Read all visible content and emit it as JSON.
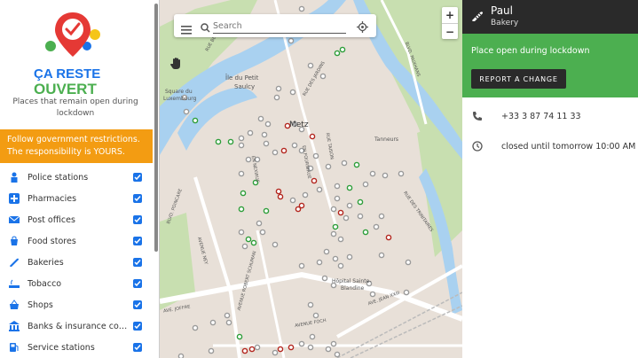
{
  "app": {
    "logo_line1": "ÇA RESTE",
    "logo_line2": "OUVERT",
    "tagline": "Places that remain open during lockdown"
  },
  "warning": {
    "line1": "Follow government restrictions.",
    "line2": "The responsibility is YOURS."
  },
  "categories": [
    {
      "label": "Police stations",
      "icon": "police-icon",
      "checked": true
    },
    {
      "label": "Pharmacies",
      "icon": "pharmacy-icon",
      "checked": true
    },
    {
      "label": "Post offices",
      "icon": "mail-icon",
      "checked": true
    },
    {
      "label": "Food stores",
      "icon": "shopping-basket-icon",
      "checked": true
    },
    {
      "label": "Bakeries",
      "icon": "bread-icon",
      "checked": true
    },
    {
      "label": "Tobacco",
      "icon": "cigarette-icon",
      "checked": true
    },
    {
      "label": "Shops",
      "icon": "shop-basket-icon",
      "checked": true
    },
    {
      "label": "Banks & insurance com...",
      "icon": "bank-icon",
      "checked": true
    },
    {
      "label": "Service stations",
      "icon": "fuel-icon",
      "checked": true
    }
  ],
  "search": {
    "placeholder": "Search"
  },
  "zoom": {
    "in": "+",
    "out": "−"
  },
  "map_labels": {
    "ile": "Île du Petit",
    "ile2": "Saulcy",
    "square": "Square du",
    "square2": "Luxembourg",
    "metz": "Metz",
    "tanneurs": "Tanneurs",
    "hopital": "Hôpital Sainte-",
    "hopital2": "Blandine",
    "r_belle": "RUE BELLE-",
    "r_jardins": "RUE DES JARDINS",
    "r_serpenoise": "EN NEXIRUE",
    "r_fournirue": "EN FOURNIRUE",
    "r_taison": "RUE TAISON",
    "r_pasteur": "AVENUE NEY",
    "r_robert": "AVENUE ROBERT SCHUMAN",
    "r_poincare": "BLVD. POINCARE",
    "r_foch": "AVENUE FOCH",
    "r_joffre": "AVE. JOFFRE",
    "r_jean": "AVE. JEAN XXIII",
    "r_paixhans": "BLVD. PAIXHANS",
    "r_trinitaires": "RUE DES TRINITAIRES"
  },
  "detail": {
    "name": "Paul",
    "type": "Bakery",
    "status": "Place open during lockdown",
    "report_button": "REPORT A CHANGE",
    "phone": "+33 3 87 74 11 33",
    "hours": "closed until tomorrow 10:00 AM"
  },
  "colors": {
    "open": "#2e9e3a",
    "closed": "#b3261e",
    "unknown": "#9a9a9a",
    "status_bg": "#4caf50",
    "warning_bg": "#f39c12",
    "header_bg": "#2a2a2a"
  }
}
